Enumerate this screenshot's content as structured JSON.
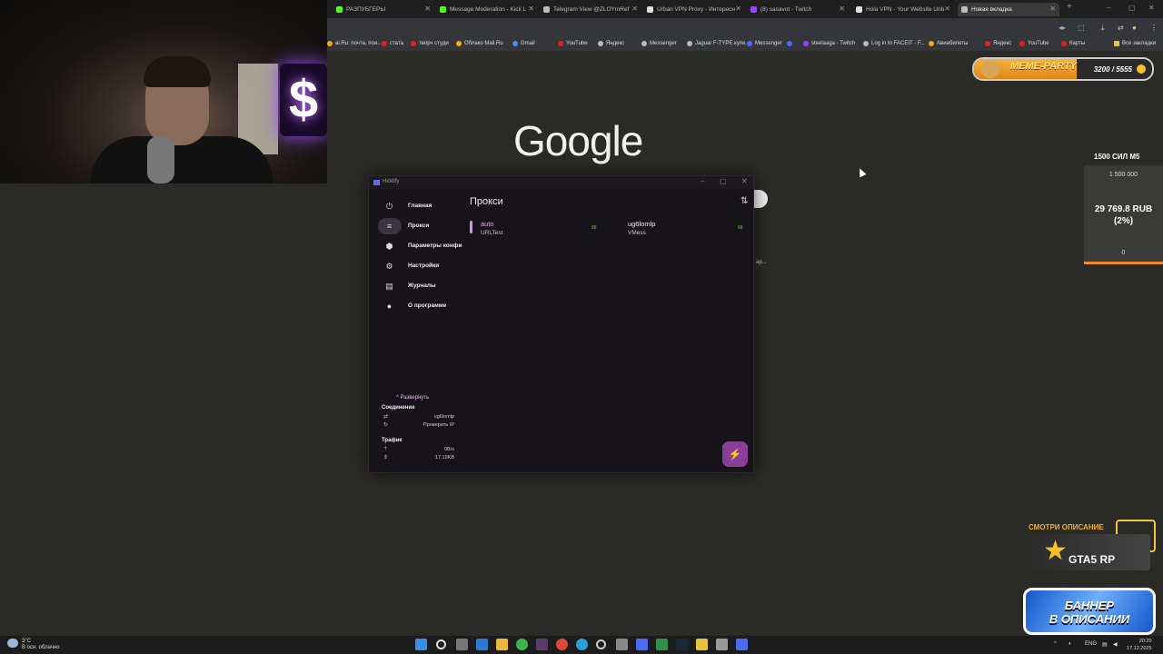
{
  "browser": {
    "tabs": [
      {
        "label": "РАЗПУБГЕРЫ",
        "color": "#53fc18",
        "active": false
      },
      {
        "label": "Message Moderation - Kick L",
        "color": "#53fc18",
        "active": false
      },
      {
        "label": "Telegram View @ZLOYmRef",
        "color": "#bbbbbb",
        "active": false
      },
      {
        "label": "Urban VPN Proxy - Интересн",
        "color": "#e0e0e0",
        "active": false
      },
      {
        "label": "(8) sasavot - Twitch",
        "color": "#9146ff",
        "active": false
      },
      {
        "label": "Hola VPN - Your Website Unb",
        "color": "#e0e0e0",
        "active": false
      },
      {
        "label": "Новая вкладка",
        "color": "#bbbbbb",
        "active": true
      }
    ],
    "new_tab": "+",
    "window_controls": [
      "–",
      "▢",
      "✕"
    ],
    "bookmarks": [
      {
        "label": "ai.Ru: почта, пои...",
        "color": "#f5a623"
      },
      {
        "label": "стата",
        "color": "#e02020"
      },
      {
        "label": "творч студи",
        "color": "#e02020"
      },
      {
        "label": "Облако Mail.Ru",
        "color": "#f5a623"
      },
      {
        "label": "Gmail",
        "color": "#4a90e2"
      },
      {
        "label": "YouTube",
        "color": "#e02020"
      },
      {
        "label": "Яндекс",
        "color": "#bbbbbb"
      },
      {
        "label": "Messenger",
        "color": "#bbbbbb"
      },
      {
        "label": "Jaguar F-TYPE купе...",
        "color": "#bbbbbb"
      },
      {
        "label": "Messenger",
        "color": "#4a6cf0"
      },
      {
        "label": "",
        "color": "#4a6cf0"
      },
      {
        "label": "steelaaga - Twitch",
        "color": "#9146ff"
      },
      {
        "label": "Log in to FACEIT - F...",
        "color": "#bbbbbb"
      },
      {
        "label": "Авиабилеты",
        "color": "#f5a623"
      },
      {
        "label": "Яндекс",
        "color": "#e02020"
      },
      {
        "label": "YouTube",
        "color": "#e02020"
      },
      {
        "label": "Карты",
        "color": "#e02020"
      }
    ],
    "all_bookmarks": "Все закладки"
  },
  "webcam": {
    "neon_letter": "$"
  },
  "page": {
    "google_logo": "Google"
  },
  "meme_party": {
    "title": "MEME-PARTY",
    "count": "3200 / 5555",
    "progress": 0.576
  },
  "donation": {
    "title": "1500 СИЛ М5",
    "goal": "1 500 000",
    "sum": "29 769.8 RUB (2%)",
    "zero": "0",
    "percent": 2
  },
  "hiddify": {
    "app_name": "Hiddify",
    "controls": [
      "–",
      "▢",
      "✕"
    ],
    "nav": [
      {
        "label": "Главная",
        "icon": "⏻"
      },
      {
        "label": "Прокси",
        "icon": "≡"
      },
      {
        "label": "Параметры конфи",
        "icon": "⬢"
      },
      {
        "label": "Настройки",
        "icon": "⚙"
      },
      {
        "label": "Журналы",
        "icon": "▤"
      },
      {
        "label": "О программе",
        "icon": "●"
      }
    ],
    "active_nav": 1,
    "heading": "Прокси",
    "sort_icon": "⇅",
    "proxies": [
      {
        "name": "auto",
        "type": "URLTest",
        "delay": "88",
        "selected": true
      },
      {
        "name": "ug6lomlp",
        "type": "VMess",
        "delay": "88",
        "selected": false
      }
    ],
    "expand_label": "Развернуть",
    "connection": {
      "heading": "Соединение",
      "server": "ug6lomlp",
      "check_ip": "Проверить IP"
    },
    "traffic": {
      "heading": "Трафик",
      "speed": "0B/s",
      "total": "17.19KB"
    },
    "fab_icon": "⚡"
  },
  "behind": {
    "text": "ар..."
  },
  "gta": {
    "caption": "СМОТРИ ОПИСАНИЕ",
    "logo_text": "GTA5 RP"
  },
  "banner": {
    "line1": "БАННЕР",
    "line2": "В ОПИСАНИИ"
  },
  "taskbar": {
    "weather_temp": "3°C",
    "weather_desc": "В осн. облачно",
    "lang": "ENG",
    "time": "20:20",
    "date": "17.12.2025"
  }
}
